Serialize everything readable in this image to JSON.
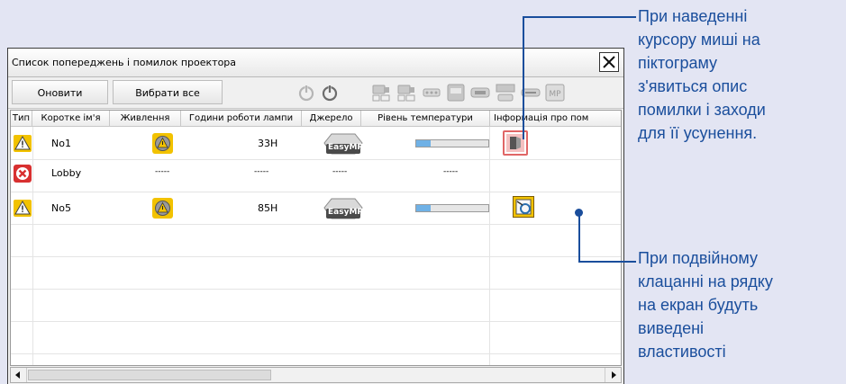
{
  "window": {
    "title": "Список попереджень і помилок проектора",
    "close_symbol": "✕"
  },
  "toolbar": {
    "refresh_label": "Оновити",
    "select_all_label": "Вибрати все",
    "icons": [
      "power-off-icon",
      "power-on-icon",
      "source-computer-icon",
      "source-computer2-icon",
      "source-video-icon",
      "source-svideo-icon",
      "source-component-icon",
      "source-dvi-icon",
      "source-hdmi-icon",
      "source-easymp-icon"
    ]
  },
  "table": {
    "columns": [
      "Тип",
      "Коротке ім'я",
      "Живлення",
      "Години роботи лампи",
      "Джерело",
      "Рівень температури",
      "Інформація про пом"
    ],
    "rows": [
      {
        "type": "warning",
        "name": "No1",
        "power": "lamp-warning-icon",
        "lamp_hours": "33H",
        "source": "EasyMP",
        "source_icon": "easymp-source-icon",
        "temperature_level": 0.2,
        "info": "error-info-icon"
      },
      {
        "type": "error",
        "name": "Lobby",
        "power": "-----",
        "lamp_hours": "-----",
        "source": "-----",
        "temperature_level": null,
        "temperature_text": "-----",
        "info": ""
      },
      {
        "type": "warning",
        "name": "No5",
        "power": "lamp-warning-icon",
        "lamp_hours": "85H",
        "source": "EasyMP",
        "source_icon": "easymp-source-icon",
        "temperature_level": 0.2,
        "info": "maintenance-info-icon"
      }
    ]
  },
  "annotations": {
    "hover": [
      "При наведенні",
      "курсору миші на",
      "піктограму",
      "з'явиться опис",
      "помилки і заходи",
      "для її усунення."
    ],
    "doubleclick": [
      "При подвійному",
      "клацанні на рядку",
      "на екран будуть",
      "виведені",
      "властивості"
    ]
  },
  "colors": {
    "annotation": "#1a4e9c",
    "warning": "#f2c200",
    "error": "#d83030",
    "temperature_fill": "#6fb1e6"
  }
}
